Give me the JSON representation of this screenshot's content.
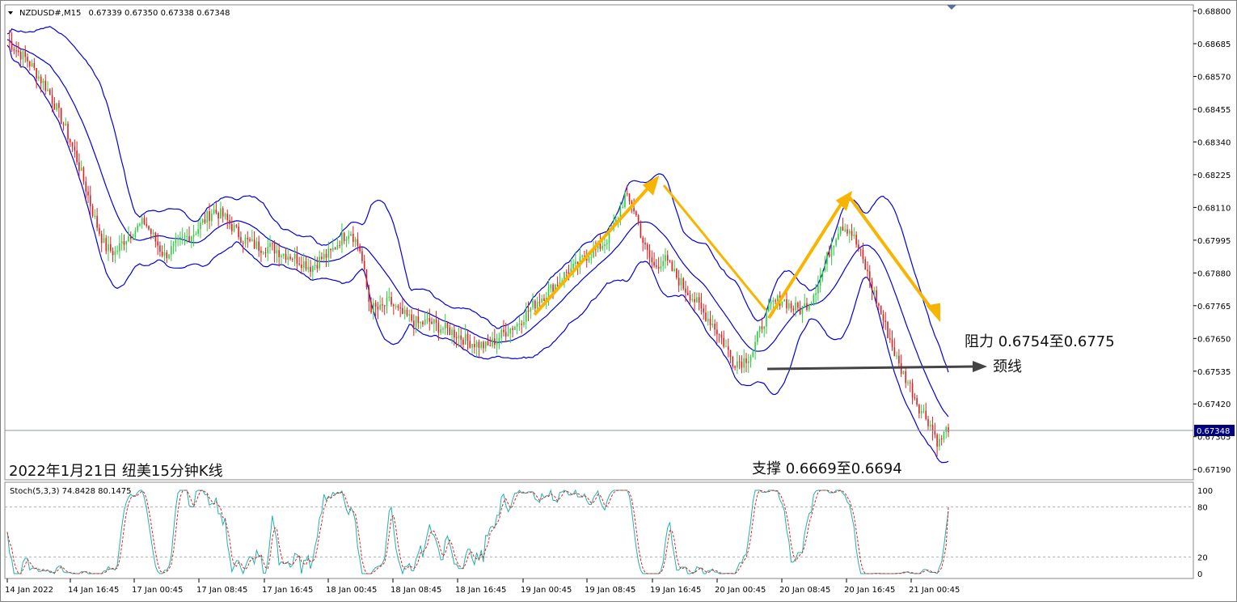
{
  "window": {
    "symbol_header": "NZDUSD#,M15",
    "ohlc": "0.67339 0.67350 0.67338 0.67348"
  },
  "price_axis": {
    "labels": [
      "0.68800",
      "0.68685",
      "0.68570",
      "0.68455",
      "0.68340",
      "0.68225",
      "0.68110",
      "0.67995",
      "0.67880",
      "0.67765",
      "0.67650",
      "0.67535",
      "0.67420",
      "0.67305",
      "0.67190"
    ],
    "current_price": "0.67348",
    "current_price_bg": "#000080"
  },
  "stoch_panel": {
    "header": "Stoch(5,3,3) 74.8428 80.1475",
    "levels": [
      "100",
      "80",
      "20",
      "0"
    ]
  },
  "time_axis": {
    "labels": [
      "14 Jan 2022",
      "14 Jan 16:45",
      "17 Jan 00:45",
      "17 Jan 08:45",
      "17 Jan 16:45",
      "18 Jan 00:45",
      "18 Jan 08:45",
      "18 Jan 16:45",
      "19 Jan 00:45",
      "19 Jan 08:45",
      "19 Jan 16:45",
      "20 Jan 00:45",
      "20 Jan 08:45",
      "20 Jan 16:45",
      "21 Jan 00:45"
    ]
  },
  "annotations": {
    "resistance": "阻力 0.6754至0.6775",
    "neckline": "颈线",
    "support": "支撑 0.6669至0.6694",
    "caption": "2022年1月21日 纽美15分钟K线"
  },
  "colors": {
    "bull": "#2ecc40",
    "bear": "#e02020",
    "bands": "#0000dd",
    "pattern_arrow": "#f7b500",
    "neckline_arrow": "#444444",
    "stoch_main": "#20b2aa",
    "stoch_signal": "#e02020"
  },
  "chart_data": {
    "type": "candlestick",
    "symbol": "NZDUSD#",
    "timeframe": "M15",
    "last_ohlc": {
      "open": 0.67339,
      "high": 0.6735,
      "low": 0.67338,
      "close": 0.67348
    },
    "ylim": [
      0.67165,
      0.6881
    ],
    "x": [
      "14 Jan 2022",
      "14 Jan 16:45",
      "17 Jan 00:45",
      "17 Jan 08:45",
      "17 Jan 16:45",
      "18 Jan 00:45",
      "18 Jan 08:45",
      "18 Jan 16:45",
      "19 Jan 00:45",
      "19 Jan 08:45",
      "19 Jan 16:45",
      "20 Jan 00:45",
      "20 Jan 08:45",
      "20 Jan 16:45",
      "21 Jan 00:45"
    ],
    "close_path": [
      0.687,
      0.6866,
      0.6863,
      0.6858,
      0.6853,
      0.6846,
      0.6838,
      0.6829,
      0.6818,
      0.6806,
      0.6797,
      0.6795,
      0.68,
      0.6803,
      0.6806,
      0.68,
      0.6794,
      0.6797,
      0.68,
      0.6802,
      0.6806,
      0.681,
      0.6808,
      0.6804,
      0.68,
      0.6798,
      0.6797,
      0.6797,
      0.6795,
      0.6794,
      0.6792,
      0.679,
      0.6793,
      0.6795,
      0.68,
      0.6803,
      0.6796,
      0.6776,
      0.6775,
      0.6778,
      0.6774,
      0.6772,
      0.677,
      0.6771,
      0.6769,
      0.6768,
      0.6766,
      0.6764,
      0.6763,
      0.6762,
      0.6765,
      0.6768,
      0.677,
      0.6774,
      0.6778,
      0.6781,
      0.6784,
      0.6788,
      0.679,
      0.6794,
      0.6796,
      0.6799,
      0.6805,
      0.6815,
      0.681,
      0.6797,
      0.679,
      0.6793,
      0.6788,
      0.6783,
      0.6779,
      0.6774,
      0.677,
      0.6764,
      0.6757,
      0.6757,
      0.676,
      0.677,
      0.6777,
      0.6779,
      0.6776,
      0.6775,
      0.6779,
      0.6787,
      0.6797,
      0.6805,
      0.6803,
      0.6795,
      0.6785,
      0.6775,
      0.6765,
      0.6755,
      0.6749,
      0.6741,
      0.6736,
      0.6728,
      0.6734
    ],
    "stochastic": {
      "k": 74.8428,
      "d": 80.1475,
      "params": "5,3,3",
      "levels": [
        20,
        80
      ]
    },
    "pattern": "double top (M)",
    "neckline": 0.6754,
    "resistance_zone": [
      0.6754,
      0.6775
    ],
    "support_zone": [
      0.6669,
      0.6694
    ]
  }
}
